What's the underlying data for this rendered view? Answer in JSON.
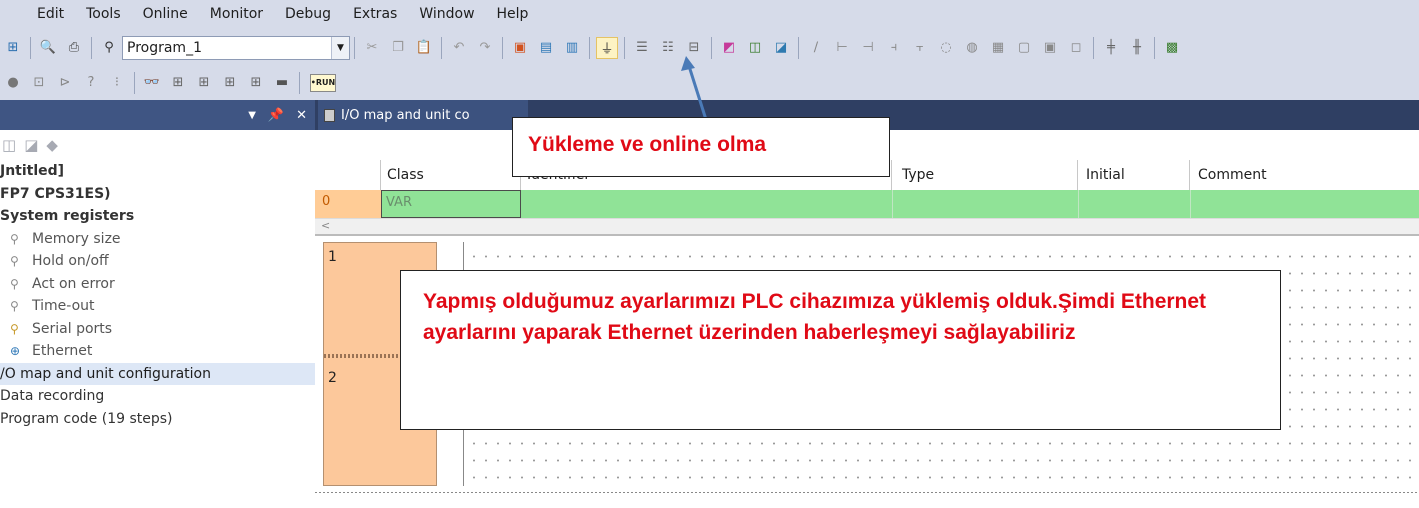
{
  "menu": [
    "Edit",
    "Tools",
    "Online",
    "Monitor",
    "Debug",
    "Extras",
    "Window",
    "Help"
  ],
  "toolbar": {
    "program_combo": "Program_1",
    "run_label": "•RUN"
  },
  "icons": {
    "upload_online": "plug-icon",
    "search": "binoculars-icon",
    "print": "printer-icon"
  },
  "panel": {
    "items": [
      {
        "label": "Jntitled]",
        "style": "bold"
      },
      {
        "label": "FP7 CPS31ES)",
        "style": "bold"
      },
      {
        "label": "System registers",
        "style": "bold"
      },
      {
        "label": "Memory size",
        "style": "child"
      },
      {
        "label": "Hold on/off",
        "style": "child"
      },
      {
        "label": "Act on error",
        "style": "child"
      },
      {
        "label": "Time-out",
        "style": "child"
      },
      {
        "label": "Serial ports",
        "style": "child"
      },
      {
        "label": "Ethernet",
        "style": "child"
      },
      {
        "label": "/O map and unit configuration",
        "style": "selected"
      },
      {
        "label": "Data recording",
        "style": "plain"
      },
      {
        "label": "Program code (19 steps)",
        "style": "plain"
      }
    ]
  },
  "editor": {
    "tab_title": "I/O map and unit co",
    "columns": {
      "class": "Class",
      "identifier": "Identifier",
      "type": "Type",
      "initial": "Initial",
      "comment": "Comment"
    },
    "row": {
      "num": "0",
      "class": "VAR"
    },
    "scroll_arrow": "<",
    "rungs": [
      "1",
      "2"
    ]
  },
  "callouts": {
    "top": "Yükleme ve online olma",
    "big": "Yapmış olduğumuz ayarlarımızı PLC cihazımıza yüklemiş olduk.Şimdi Ethernet ayarlarını yaparak Ethernet üzerinden haberleşmeyi sağlayabiliriz"
  },
  "colors": {
    "accent_red": "#e00a16",
    "row_green": "#90e397",
    "ladder_orange": "#fcc89b",
    "panel_header": "#3f5583"
  }
}
